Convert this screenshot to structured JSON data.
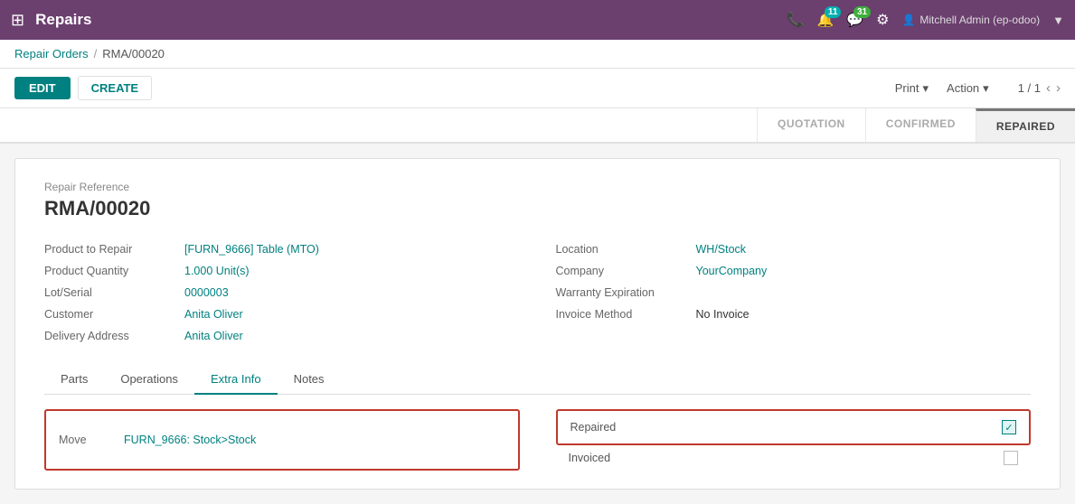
{
  "topbar": {
    "app_name": "Repairs",
    "grid_icon": "⊞",
    "phone_icon": "📞",
    "notification1_count": "11",
    "notification2_icon": "💬",
    "notification2_count": "31",
    "settings_icon": "⚙",
    "user_name": "Mitchell Admin (ep-odoo)",
    "user_icon": "👤"
  },
  "breadcrumb": {
    "parent_label": "Repair Orders",
    "separator": "/",
    "current": "RMA/00020"
  },
  "toolbar": {
    "edit_label": "EDIT",
    "create_label": "CREATE",
    "print_label": "Print",
    "action_label": "Action",
    "pager_text": "1 / 1",
    "dropdown_icon": "▾",
    "prev_icon": "‹",
    "next_icon": "›"
  },
  "statusbar": {
    "items": [
      {
        "id": "quotation",
        "label": "QUOTATION",
        "active": false
      },
      {
        "id": "confirmed",
        "label": "CONFIRMED",
        "active": false
      },
      {
        "id": "repaired",
        "label": "REPAIRED",
        "active": true
      }
    ]
  },
  "form": {
    "repair_ref_label": "Repair Reference",
    "repair_ref_value": "RMA/00020",
    "fields_left": [
      {
        "label": "Product to Repair",
        "value": "[FURN_9666] Table (MTO)",
        "type": "link"
      },
      {
        "label": "Product Quantity",
        "value": "1.000  Unit(s)",
        "type": "link"
      },
      {
        "label": "Lot/Serial",
        "value": "0000003",
        "type": "link"
      },
      {
        "label": "Customer",
        "value": "Anita Oliver",
        "type": "link"
      },
      {
        "label": "Delivery Address",
        "value": "Anita Oliver",
        "type": "link"
      }
    ],
    "fields_right": [
      {
        "label": "Location",
        "value": "WH/Stock",
        "type": "link"
      },
      {
        "label": "Company",
        "value": "YourCompany",
        "type": "link"
      },
      {
        "label": "Warranty Expiration",
        "value": "",
        "type": "muted"
      },
      {
        "label": "Invoice Method",
        "value": "No Invoice",
        "type": "plain"
      }
    ],
    "tabs": [
      {
        "id": "parts",
        "label": "Parts"
      },
      {
        "id": "operations",
        "label": "Operations"
      },
      {
        "id": "extra_info",
        "label": "Extra Info"
      },
      {
        "id": "notes",
        "label": "Notes"
      }
    ],
    "active_tab": "extra_info",
    "extra_info": {
      "move_label": "Move",
      "move_value": "FURN_9666: Stock>Stock",
      "repaired_label": "Repaired",
      "invoiced_label": "Invoiced",
      "repaired_checked": true,
      "invoiced_checked": false
    }
  }
}
